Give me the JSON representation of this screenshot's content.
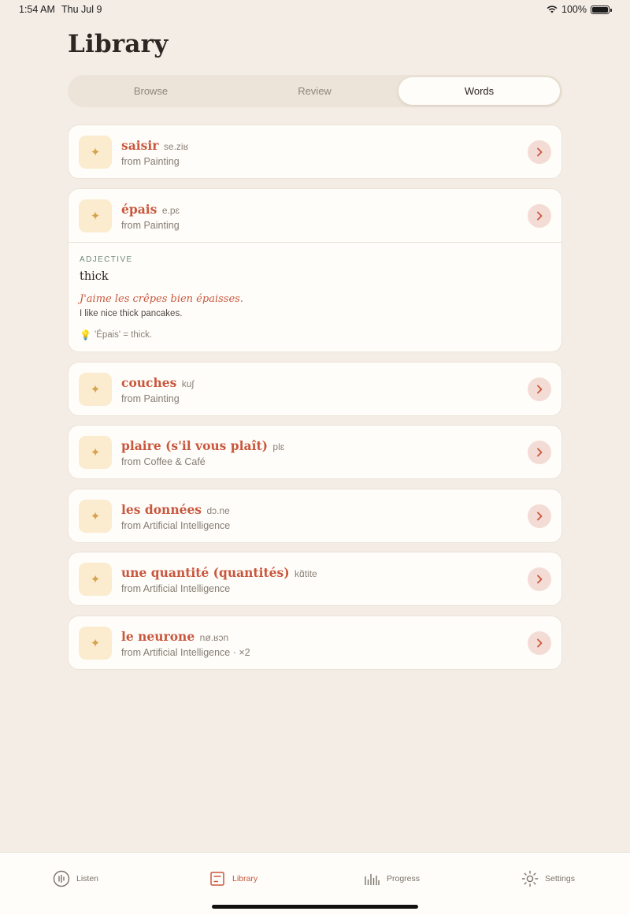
{
  "status": {
    "time": "1:54 AM",
    "date": "Thu Jul 9",
    "battery": "100%"
  },
  "title": "Library",
  "segments": [
    "Browse",
    "Review",
    "Words"
  ],
  "selected_segment": "Words",
  "words": [
    {
      "word": "saisir",
      "ipa": "se.ziʁ",
      "source": "from Painting"
    },
    {
      "word": "épais",
      "ipa": "e.pɛ",
      "source": "from Painting",
      "expanded": true,
      "detail": {
        "pos": "ADJECTIVE",
        "meaning": "thick",
        "example": "J'aime les crêpes bien épaisses.",
        "translation": "I like nice thick pancakes.",
        "tip": "'Épais' = thick."
      }
    },
    {
      "word": "couches",
      "ipa": "kuʃ",
      "source": "from Painting"
    },
    {
      "word": "plaire (s'il vous plaît)",
      "ipa": "plɛ",
      "source": "from Coffee & Café"
    },
    {
      "word": "les données",
      "ipa": "dɔ.ne",
      "source": "from Artificial Intelligence"
    },
    {
      "word": "une quantité (quantités)",
      "ipa": "kɑ̃tite",
      "source": "from Artificial Intelligence"
    },
    {
      "word": "le neurone",
      "ipa": "nø.ʁɔn",
      "source": "from Artificial Intelligence  ·  ×2"
    }
  ],
  "tabs": [
    {
      "label": "Listen",
      "icon": "listen-icon"
    },
    {
      "label": "Library",
      "icon": "library-icon",
      "active": true
    },
    {
      "label": "Progress",
      "icon": "progress-icon"
    },
    {
      "label": "Settings",
      "icon": "settings-icon"
    }
  ],
  "colors": {
    "accent": "#c9573e",
    "background": "#f4ede6",
    "card": "#fffdf9",
    "star": "#d6a24c"
  }
}
